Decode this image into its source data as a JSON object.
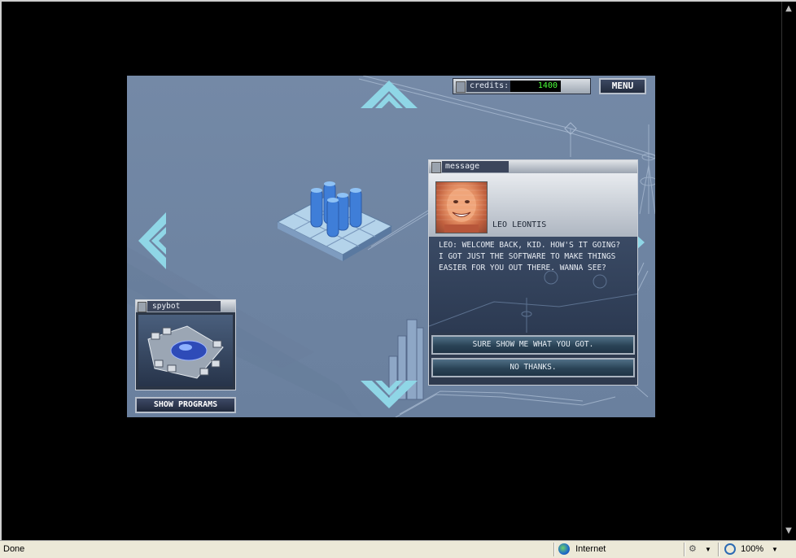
{
  "game": {
    "credits_label": "credits:",
    "credits_value": "1400",
    "menu_label": "MENU"
  },
  "message": {
    "title": "message",
    "speaker": "LEO LEONTIS",
    "text": "LEO: WELCOME BACK, KID. HOW'S IT GOING? I GOT JUST THE SOFTWARE TO MAKE THINGS EASIER FOR YOU OUT THERE. WANNA SEE?",
    "choices": [
      {
        "label": "SURE SHOW ME WHAT YOU GOT."
      },
      {
        "label": "NO THANKS."
      }
    ]
  },
  "spybot": {
    "title": "spybot",
    "show_programs_label": "SHOW PROGRAMS"
  },
  "statusbar": {
    "status": "Done",
    "zone": "Internet",
    "zoom": "100%",
    "icons": [
      "globe-icon",
      "protected-mode-icon",
      "zoom-icon"
    ]
  },
  "colors": {
    "game_background": "#7489a6",
    "accent_cyan": "#8fd6e6",
    "credits_text": "#4cff3a",
    "panel_dark": "#2e3a4e"
  }
}
